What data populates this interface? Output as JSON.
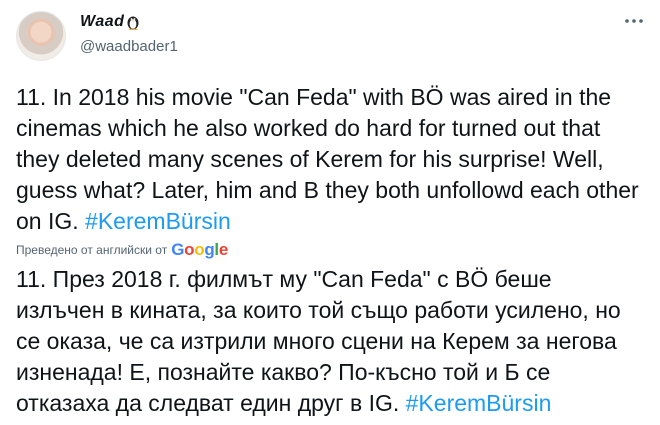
{
  "author": {
    "display_name": "Waad",
    "handle": "@waadbader1",
    "name_emoji": "penguin-emoji-icon"
  },
  "tweet": {
    "text": "11. In 2018 his movie \"Can Feda\" with BÖ was aired in the cinemas which he also worked do hard for turned out that they deleted many scenes of Kerem for his surprise! Well, guess what? Later, him and B they both unfollowd each other on IG. ",
    "hashtag": "#KeremBürsin"
  },
  "translation": {
    "label": "Преведено от английски от",
    "provider": "Google",
    "text": "11. През 2018 г. филмът му \"Can Feda\" с BÖ беше излъчен в кината, за които той също работи усилено, но се оказа, че са изтрили много сцени на Керем за негова изненада! Е, познайте какво? По-късно той и Б се отказаха да следват един друг в IG. ",
    "hashtag": "#KeremBürsin"
  },
  "icons": {
    "more": "more-options-icon",
    "avatar": "profile-avatar"
  },
  "colors": {
    "link": "#1d9bf0",
    "text": "#0f1419",
    "secondary": "#536471"
  }
}
